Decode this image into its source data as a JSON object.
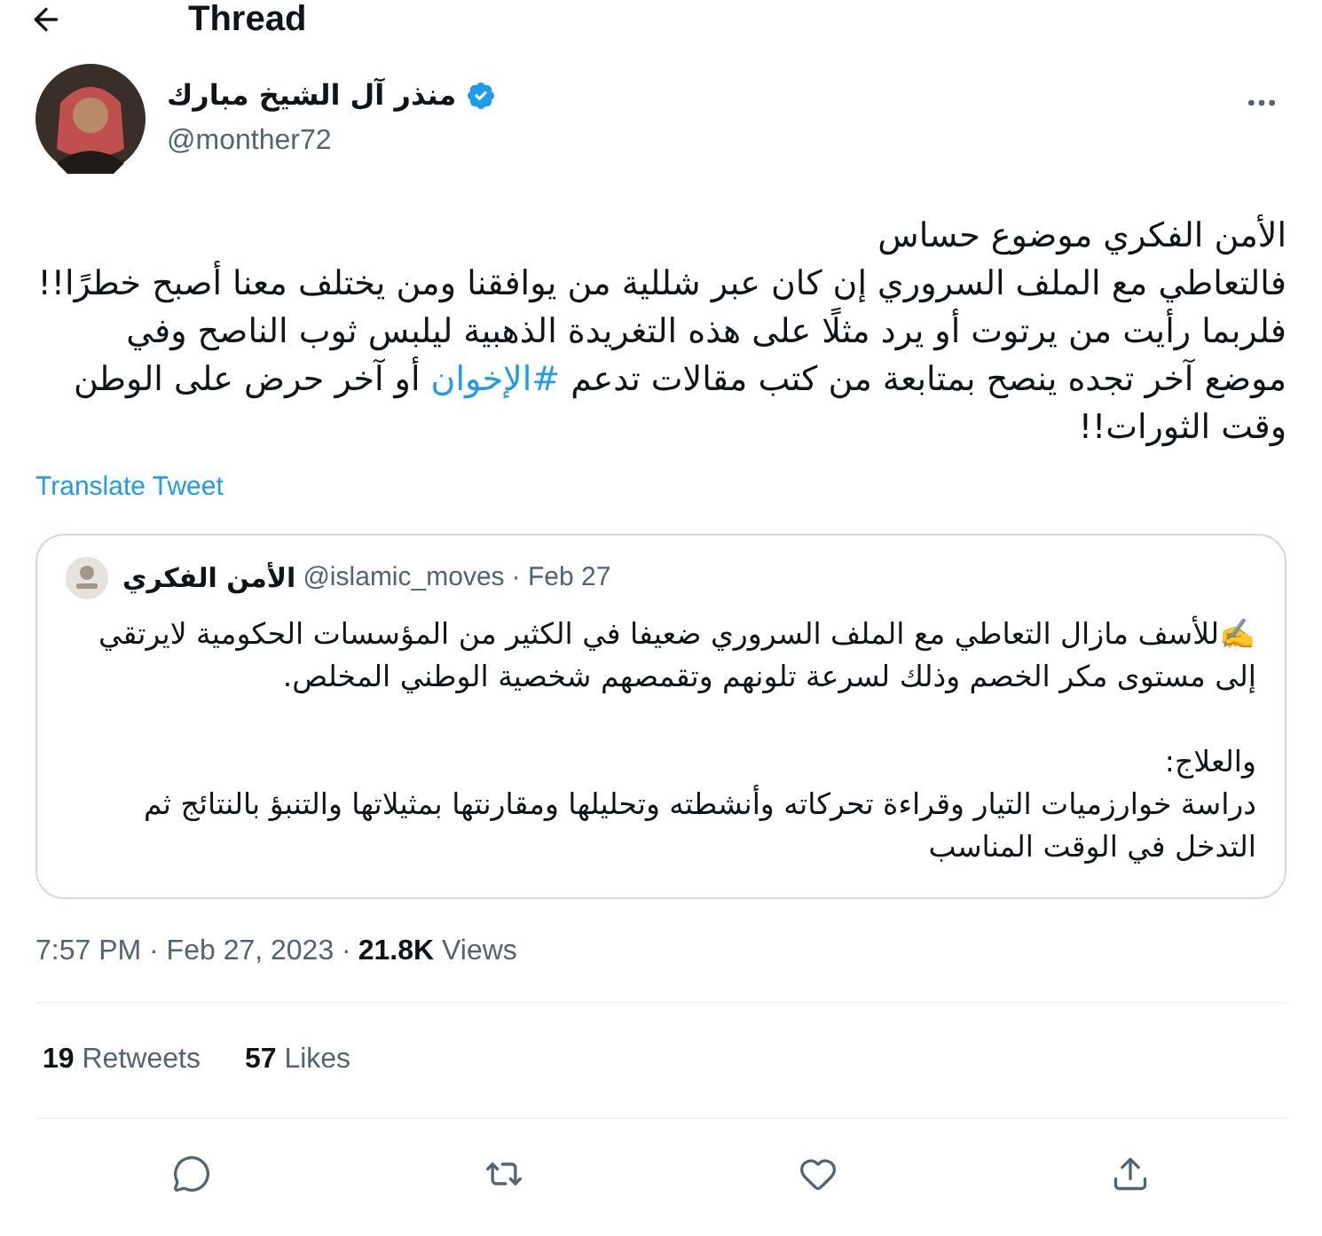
{
  "header": {
    "title": "Thread"
  },
  "author": {
    "name": "منذر آل الشيخ مبارك",
    "verified": true,
    "handle": "@monther72"
  },
  "body": [
    {
      "text": "الأمن الفكري موضوع حساس"
    },
    {
      "text": "فالتعاطي مع الملف السروري إن كان عبر شللية من يوافقنا ومن يختلف معنا أصبح خطرًا!!"
    },
    {
      "text": "فلربما رأيت من يرتوت أو يرد مثلًا على هذه التغريدة الذهبية ليلبس ثوب الناصح وفي موضع آخر تجده ينصح بمتابعة من كتب مقالات تدعم ",
      "hashtag": "#الإخوان",
      "after": " أو آخر حرض على الوطن وقت الثورات!!"
    }
  ],
  "translate_link": "Translate Tweet",
  "quote": {
    "name": "الأمن الفكري",
    "handle": "@islamic_moves",
    "date": "· Feb 27",
    "paragraphs": [
      "✍️للأسف مازال التعاطي مع الملف السروري ضعيفا في الكثير من المؤسسات الحكومية لايرتقي إلى مستوى مكر الخصم وذلك لسرعة تلونهم وتقمصهم شخصية الوطني المخلص.",
      "والعلاج:\nدراسة خوارزميات التيار وقراءة تحركاته وأنشطته وتحليلها ومقارنتها بمثيلاتها والتنبؤ بالنتائج ثم التدخل في الوقت المناسب"
    ]
  },
  "meta": {
    "time": "7:57 PM · Feb 27, 2023 ·",
    "views_count": "21.8K",
    "views_label": "Views"
  },
  "retweets": {
    "count": "19",
    "label": "Retweets"
  },
  "likes": {
    "count": "57",
    "label": "Likes"
  },
  "actions": [
    {
      "kind": "reply"
    },
    {
      "kind": "retweet"
    },
    {
      "kind": "like"
    },
    {
      "kind": "share"
    }
  ]
}
